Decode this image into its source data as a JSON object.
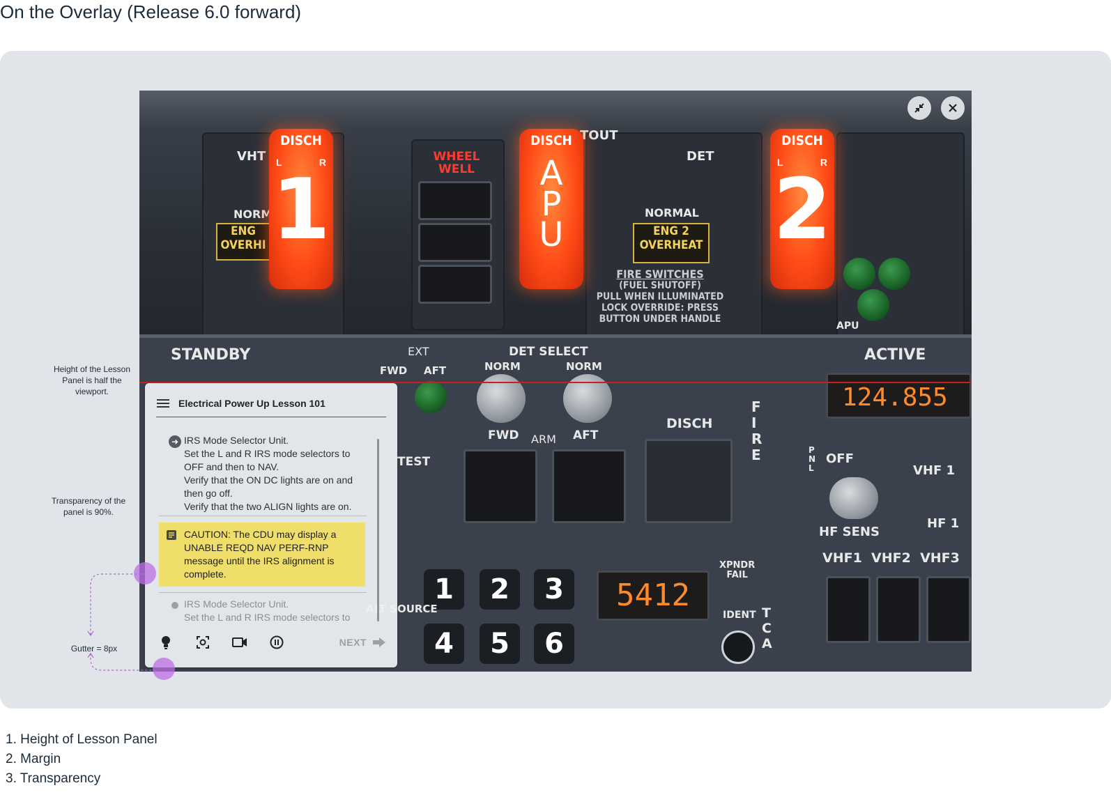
{
  "page": {
    "title": "On the Overlay (Release 6.0 forward)"
  },
  "viewport_controls": {
    "minimize_icon": "minimize-arrows-icon",
    "close_icon": "close-icon"
  },
  "cockpit": {
    "handle_1": {
      "top": "DISCH",
      "left": "L",
      "right": "R",
      "number": "1"
    },
    "handle_apu": {
      "top": "DISCH",
      "letters": [
        "A",
        "P",
        "U"
      ]
    },
    "handle_2": {
      "top": "DISCH",
      "left": "L",
      "right": "R",
      "number": "2"
    },
    "wheel_well": "WHEEL\nWELL",
    "eng_overheat_left": "ENG\nOVERHI",
    "eng_overheat_right": "ENG 2\nOVERHEAT",
    "normal_left": "NORM",
    "normal_right": "NORMAL",
    "det_label": "DET",
    "tout_label": "TOUT",
    "vht_label": "VHT",
    "fire_switches": [
      "FIRE SWITCHES",
      "(FUEL SHUTOFF)",
      "PULL WHEN ILLUMINATED",
      "LOCK OVERRIDE: PRESS",
      "BUTTON UNDER HANDLE"
    ],
    "standby": "STANDBY",
    "active": "ACTIVE",
    "ext": "EXT",
    "fwd": "FWD",
    "aft": "AFT",
    "det_select": "DET SELECT",
    "norm": "NORM",
    "arm": "ARM",
    "disch": "DISCH",
    "test": "TEST",
    "fire": "FIRE",
    "freq": "124.855",
    "squawk": "5412",
    "pnl": "PNL",
    "off": "OFF",
    "vhf1": "VHF 1",
    "hf1": "HF 1",
    "hf_sens": "HF SENS",
    "vhf_row": "VHF1  VHF2  VHF3",
    "xpndr_fail": "XPNDR\nFAIL",
    "ident": "IDENT",
    "keys": [
      "1",
      "2",
      "3",
      "4",
      "5",
      "6"
    ],
    "apu": "APU",
    "alt_source": "ALT SOURCE",
    "tca": "TCA"
  },
  "lesson_panel": {
    "menu_icon": "hamburger-menu-icon",
    "title": "Electrical Power Up Lesson 101",
    "step_1": {
      "icon": "arrow-right-circle-icon",
      "lines": [
        "IRS Mode Selector Unit.",
        "Set the L and R IRS mode selectors to OFF and then to NAV.",
        "Verify that the ON DC lights are on and then go off.",
        "Verify that the two ALIGN lights are on."
      ]
    },
    "caution": {
      "icon": "note-icon",
      "text": "CAUTION: The CDU may display a UNABLE REQD NAV PERF-RNP message until the IRS alignment is complete."
    },
    "step_2": {
      "icon": "bullet-icon",
      "lines": [
        "IRS Mode Selector Unit.",
        "Set the L and R IRS mode selectors to"
      ]
    },
    "toolbar": {
      "hint_icon": "lightbulb-icon",
      "focus_icon": "focus-capture-icon",
      "video_icon": "video-camera-icon",
      "pause_icon": "pause-circle-icon",
      "next_label": "NEXT",
      "next_icon": "arrow-right-icon"
    }
  },
  "annotations": {
    "height_note": "Height of the Lesson Panel is half the viewport.",
    "transparency_note": "Transparency of the panel is 90%.",
    "gutter_note": "Gutter = 8px"
  },
  "legend": [
    "1. Height of Lesson Panel",
    "2. Margin",
    "3. Transparency"
  ],
  "colors": {
    "canvas": "#e1e5e9",
    "caution": "#f0de6a",
    "annotation_dot": "#be6ee6",
    "handle": "#ff4a16",
    "marker_line": "#c82020"
  }
}
